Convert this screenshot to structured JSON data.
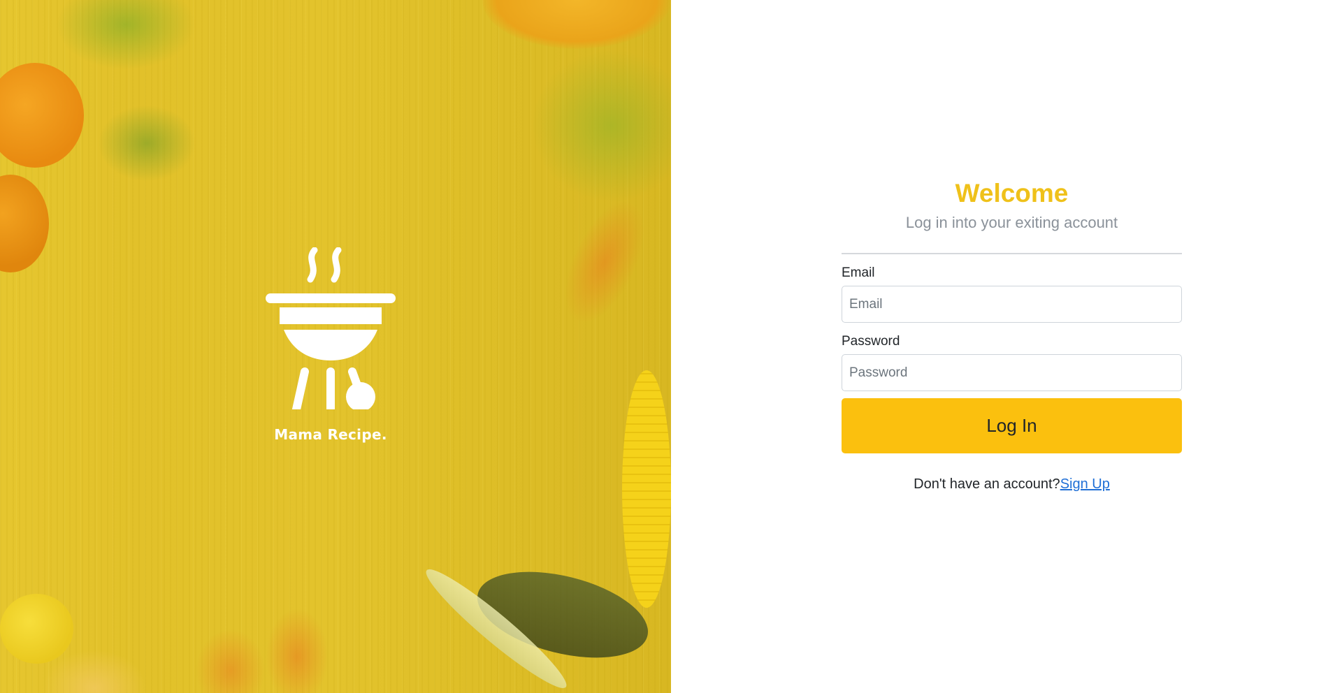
{
  "brand": {
    "name": "Mama Recipe.",
    "logo_icon": "barbecue-grill-icon"
  },
  "login": {
    "title": "Welcome",
    "subtitle": "Log in into your exiting account",
    "email_label": "Email",
    "email_placeholder": "Email",
    "email_value": "",
    "password_label": "Password",
    "password_placeholder": "Password",
    "password_value": "",
    "submit_label": "Log In",
    "signup_prompt": "Don't have an account?",
    "signup_link": "Sign Up"
  },
  "colors": {
    "accent": "#efc11a",
    "button": "#fbc00e",
    "link": "#1f6fd6",
    "hero_overlay": "#e3c32c"
  }
}
